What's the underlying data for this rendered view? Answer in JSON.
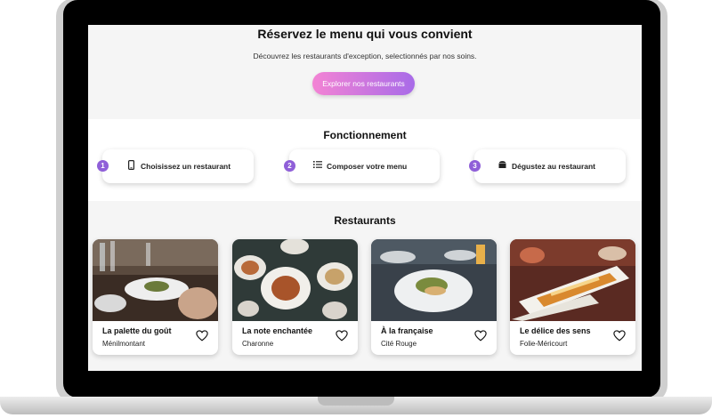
{
  "hero": {
    "title": "Réservez le menu qui vous convient",
    "subtitle": "Découvrez les restaurants d'exception, selectionnés par nos soins.",
    "cta_label": "Explorer nos restaurants"
  },
  "how": {
    "title": "Fonctionnement",
    "steps": [
      {
        "num": "1",
        "label": "Choisissez un restaurant",
        "icon": "phone-icon"
      },
      {
        "num": "2",
        "label": "Composer votre menu",
        "icon": "list-icon"
      },
      {
        "num": "3",
        "label": "Dégustez au restaurant",
        "icon": "dish-icon"
      }
    ]
  },
  "restaurants": {
    "title": "Restaurants",
    "cards": [
      {
        "name": "La palette du goût",
        "location": "Ménilmontant"
      },
      {
        "name": "La note enchantée",
        "location": "Charonne"
      },
      {
        "name": "À la française",
        "location": "Cité Rouge"
      },
      {
        "name": "Le délice des sens",
        "location": "Folie-Méricourt"
      }
    ]
  },
  "colors": {
    "accent_purple": "#8f5fd8",
    "cta_gradient_start": "#f383d4",
    "cta_gradient_end": "#a86be8"
  }
}
